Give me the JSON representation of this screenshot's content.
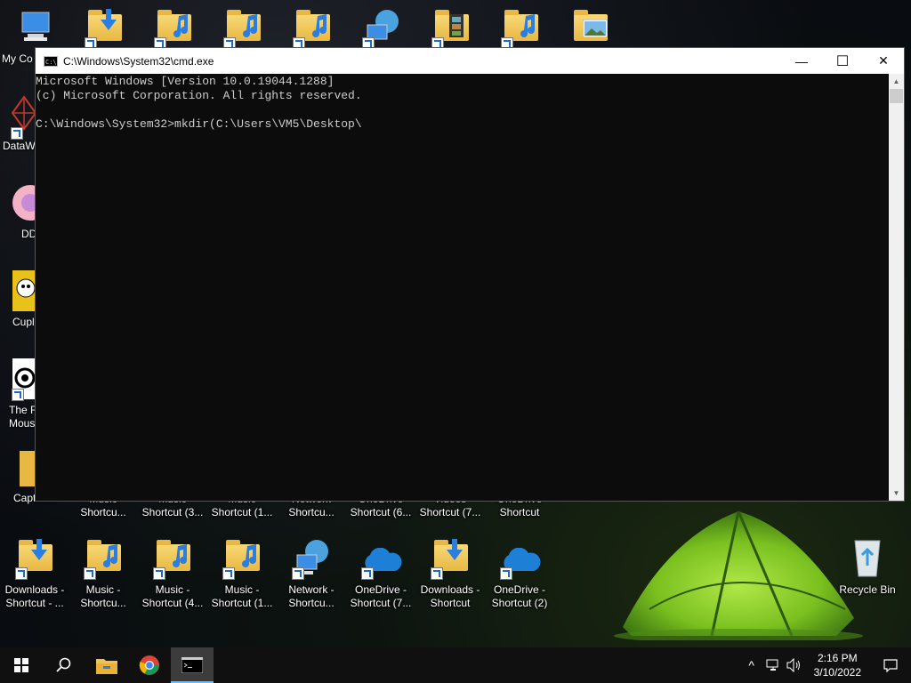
{
  "window": {
    "title": "C:\\Windows\\System32\\cmd.exe",
    "title_icon_text": "C:\\",
    "minimize_glyph": "—",
    "maximize_glyph": "☐",
    "close_glyph": "✕",
    "console_lines": [
      "Microsoft Windows [Version 10.0.19044.1288]",
      "(c) Microsoft Corporation. All rights reserved.",
      "",
      "C:\\Windows\\System32>mkdir(C:\\Users\\VM5\\Desktop\\"
    ]
  },
  "desktop": {
    "left_column": [
      {
        "label": "My Co",
        "icon": "computer-icon"
      },
      {
        "label": "DataW",
        "icon": "datawrapper-app-icon"
      },
      {
        "label": "DD",
        "icon": "app-icon"
      },
      {
        "label": "Cupl",
        "icon": "cuphead-game-icon"
      },
      {
        "label": "The F\nMous",
        "icon": "app-icon"
      },
      {
        "label": "Captures",
        "icon": "folder-icon"
      }
    ],
    "top_partial_row": [
      {
        "label_line2": "Shortcu...",
        "label_line1": "Music"
      },
      {
        "label_line2": "Shortcut (3...",
        "label_line1": "Music"
      },
      {
        "label_line2": "Shortcut (1...",
        "label_line1": "Music"
      },
      {
        "label_line2": "Shortcu...",
        "label_line1": "Network"
      },
      {
        "label_line2": "Shortcut (6...",
        "label_line1": "OneDrive"
      },
      {
        "label_line2": "Shortcut (7...",
        "label_line1": "Videos"
      },
      {
        "label_line2": "Shortcut",
        "label_line1": "OneDrive"
      }
    ],
    "bottom_row": [
      {
        "line1": "Downloads -",
        "line2": "Shortcut - ...",
        "icon": "downloads-folder-icon"
      },
      {
        "line1": "Music -",
        "line2": "Shortcu...",
        "icon": "music-folder-icon"
      },
      {
        "line1": "Music -",
        "line2": "Shortcut (4...",
        "icon": "music-folder-icon"
      },
      {
        "line1": "Music -",
        "line2": "Shortcut (1...",
        "icon": "music-folder-icon"
      },
      {
        "line1": "Network -",
        "line2": "Shortcu...",
        "icon": "network-icon"
      },
      {
        "line1": "OneDrive -",
        "line2": "Shortcut (7...",
        "icon": "onedrive-cloud-icon"
      },
      {
        "line1": "Downloads -",
        "line2": "Shortcut",
        "icon": "downloads-folder-icon"
      },
      {
        "line1": "OneDrive -",
        "line2": "Shortcut (2)",
        "icon": "onedrive-cloud-icon"
      }
    ],
    "recycle_bin": "Recycle Bin"
  },
  "taskbar": {
    "time": "2:16 PM",
    "date": "3/10/2022",
    "tray_chevron": "^"
  },
  "colors": {
    "console_bg": "#0c0c0c",
    "console_text": "#cccccc",
    "taskbar_bg": "#101010",
    "accent": "#76b9ed"
  }
}
